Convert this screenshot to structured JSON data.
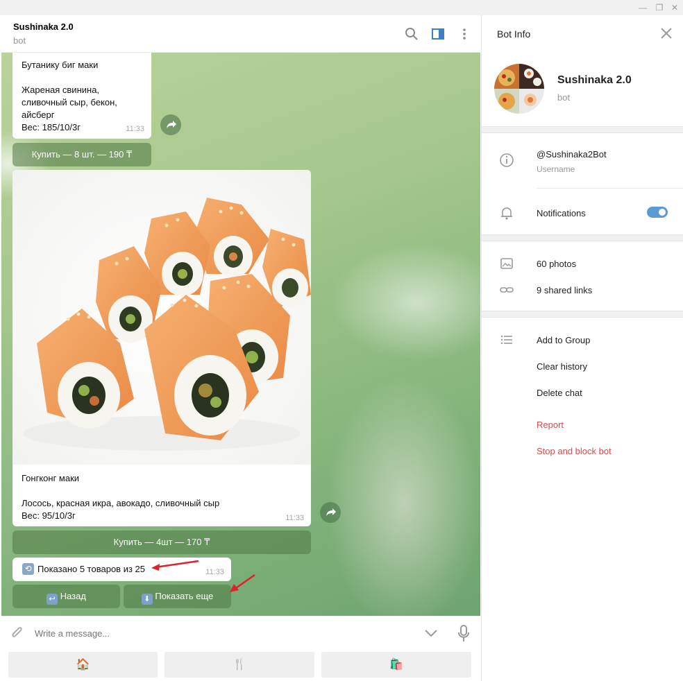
{
  "window": {
    "controls": [
      "minimize",
      "maximize",
      "close"
    ]
  },
  "header": {
    "title": "Sushinaka 2.0",
    "subtitle": "bot"
  },
  "messages": {
    "msg1": {
      "lines": [
        "Бутанику биг маки",
        "",
        "Жареная свинина,",
        "сливочный сыр, бекон,",
        "айсберг",
        "Вес: 185/10/3г"
      ],
      "time": "11:33",
      "button": "Купить — 8 шт. — 190 ₸"
    },
    "msg2": {
      "lines": [
        "Гонгконг маки",
        "",
        "Лосось, красная икра, авокадо, сливочный сыр",
        "Вес: 95/10/3г"
      ],
      "time": "11:33",
      "button": "Купить — 4шт — 170 ₸"
    },
    "msg3": {
      "text": "Показано 5 товаров из 25",
      "time": "11:33",
      "back_button": "Назад",
      "more_button": "Показать еще"
    }
  },
  "input": {
    "placeholder": "Write a message..."
  },
  "bot_keyboard": [
    "🏠",
    "🍴",
    "🛍️"
  ],
  "panel": {
    "title": "Bot Info",
    "name": "Sushinaka 2.0",
    "subtitle": "bot",
    "username": "@Sushinaka2Bot",
    "username_label": "Username",
    "notifications": "Notifications",
    "notifications_on": true,
    "photos": "60 photos",
    "links": "9 shared links",
    "add_to_group": "Add to Group",
    "clear_history": "Clear history",
    "delete_chat": "Delete chat",
    "report": "Report",
    "stop_block": "Stop and block bot"
  },
  "colors": {
    "accent": "#5b9bd5",
    "danger": "#d14e4e",
    "keyboard_button": "#5a8a55",
    "annotation_arrow": "#e0202a"
  },
  "icons": [
    "search-icon",
    "sidebar-toggle-icon",
    "more-icon",
    "close-icon",
    "info-icon",
    "bell-icon",
    "photo-icon",
    "link-icon",
    "list-icon",
    "attach-icon",
    "chevron-down-icon",
    "mic-icon",
    "share-icon"
  ]
}
